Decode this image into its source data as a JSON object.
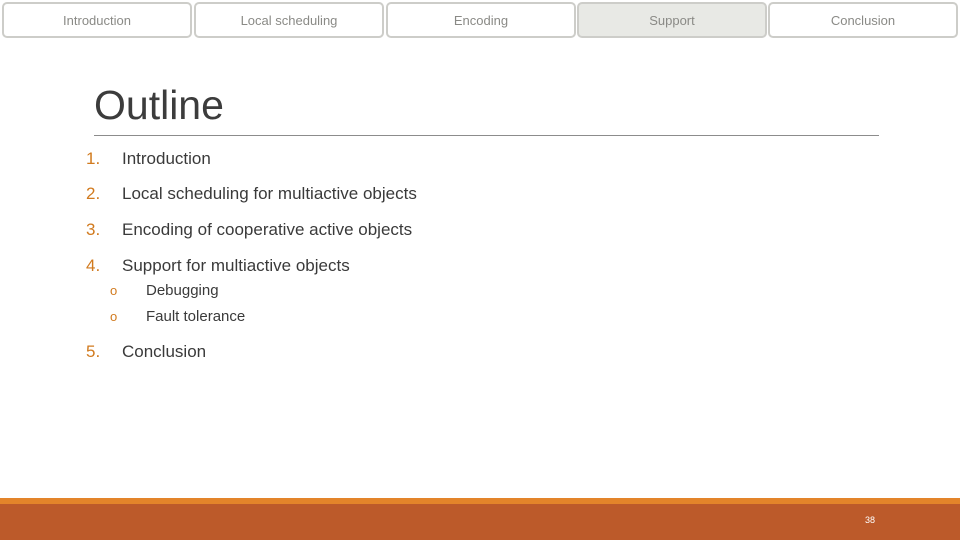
{
  "nav": {
    "tabs": [
      {
        "label": "Introduction"
      },
      {
        "label": "Local scheduling"
      },
      {
        "label": "Encoding"
      },
      {
        "label": "Support",
        "active": true
      },
      {
        "label": "Conclusion"
      }
    ]
  },
  "slide": {
    "title": "Outline",
    "items": [
      {
        "number": "1.",
        "text": "Introduction"
      },
      {
        "number": "2.",
        "text": "Local scheduling for multiactive objects"
      },
      {
        "number": "3.",
        "text": "Encoding of cooperative active objects"
      },
      {
        "number": "4.",
        "text": "Support for multiactive objects",
        "subitems": [
          {
            "bullet": "o",
            "text": "Debugging"
          },
          {
            "bullet": "o",
            "text": "Fault tolerance"
          }
        ]
      },
      {
        "number": "5.",
        "text": "Conclusion"
      }
    ],
    "page_number": "38"
  },
  "colors": {
    "accent": "#d17a1e",
    "footer": "#bc5a2a",
    "footer_stripe": "#e3842a",
    "active_tab": "#e8e9e5"
  }
}
